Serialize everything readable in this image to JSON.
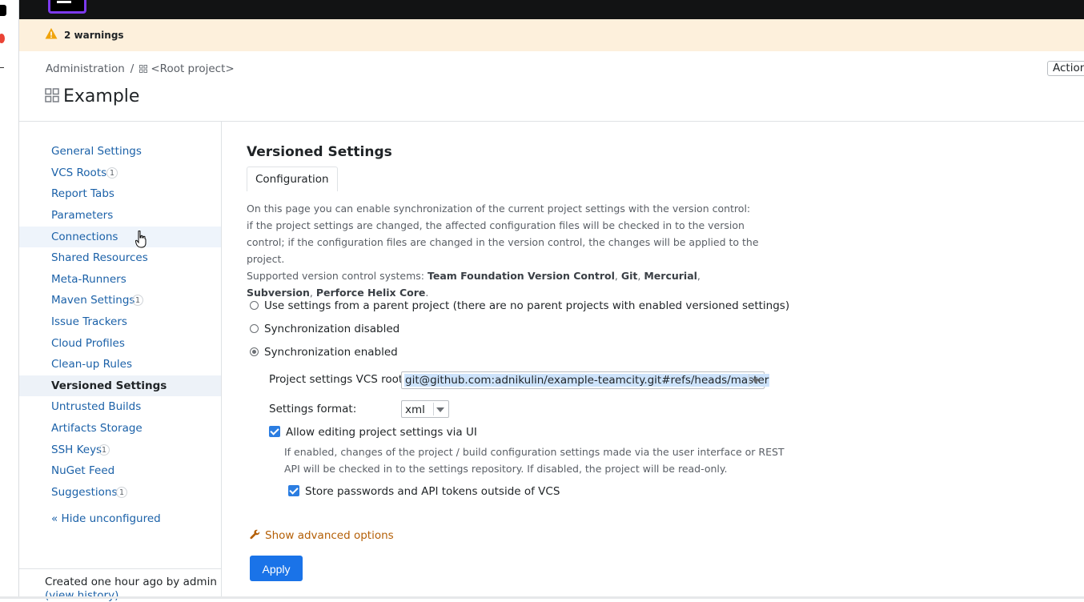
{
  "warnings": {
    "text": "2 warnings"
  },
  "breadcrumb": {
    "root": "Administration",
    "separator": "/",
    "project": "<Root project>"
  },
  "actions_label": "Action",
  "page_title": "Example",
  "sidebar": {
    "items": [
      {
        "label": "General Settings",
        "badge": ""
      },
      {
        "label": "VCS Roots",
        "badge": "1"
      },
      {
        "label": "Report Tabs",
        "badge": ""
      },
      {
        "label": "Parameters",
        "badge": ""
      },
      {
        "label": "Connections",
        "badge": ""
      },
      {
        "label": "Shared Resources",
        "badge": ""
      },
      {
        "label": "Meta-Runners",
        "badge": ""
      },
      {
        "label": "Maven Settings",
        "badge": "1"
      },
      {
        "label": "Issue Trackers",
        "badge": ""
      },
      {
        "label": "Cloud Profiles",
        "badge": ""
      },
      {
        "label": "Clean-up Rules",
        "badge": ""
      },
      {
        "label": "Versioned Settings",
        "badge": ""
      },
      {
        "label": "Untrusted Builds",
        "badge": ""
      },
      {
        "label": "Artifacts Storage",
        "badge": ""
      },
      {
        "label": "SSH Keys",
        "badge": "1"
      },
      {
        "label": "NuGet Feed",
        "badge": ""
      },
      {
        "label": "Suggestions",
        "badge": "1"
      }
    ],
    "selected": "Versioned Settings",
    "hide_link": "« Hide unconfigured",
    "created": "Created one hour ago by admin",
    "view_history": "(view history)"
  },
  "main": {
    "section_title": "Versioned Settings",
    "tab_label": "Configuration",
    "description_1": "On this page you can enable synchronization of the current project settings with the version control: if the project settings are changed, the affected configuration files will be checked in to the version control; if the configuration files are changed in the version control, the changes will be applied to the project.",
    "supported_prefix": "Supported version control systems:",
    "vcs_systems": [
      "Team Foundation Version Control",
      "Git",
      "Mercurial",
      "Subversion",
      "Perforce Helix Core"
    ],
    "supported_suffix": ".",
    "radio_options": [
      {
        "label": "Use settings from a parent project (there are no parent projects with enabled versioned settings)",
        "selected": false
      },
      {
        "label": "Synchronization disabled",
        "selected": false
      },
      {
        "label": "Synchronization enabled",
        "selected": true
      }
    ],
    "vcs_root_label": "Project settings VCS root:",
    "vcs_root_value": "git@github.com:adnikulin/example-teamcity.git#refs/heads/master",
    "format_label": "Settings format:",
    "format_value": "xml",
    "allow_editing_label": "Allow editing project settings via UI",
    "allow_editing_checked": true,
    "allow_editing_help": "If enabled, changes of the project / build configuration settings made via the user interface or REST API will be checked in to the settings repository. If disabled, the project will be read-only.",
    "store_passwords_label": "Store passwords and API tokens outside of VCS",
    "store_passwords_checked": true,
    "advanced_link": "Show advanced options",
    "apply_label": "Apply"
  },
  "colors": {
    "link": "#1b61a8",
    "accent": "#1a73e8",
    "warning_bg": "#fdf0dc",
    "advanced": "#b45f06"
  }
}
